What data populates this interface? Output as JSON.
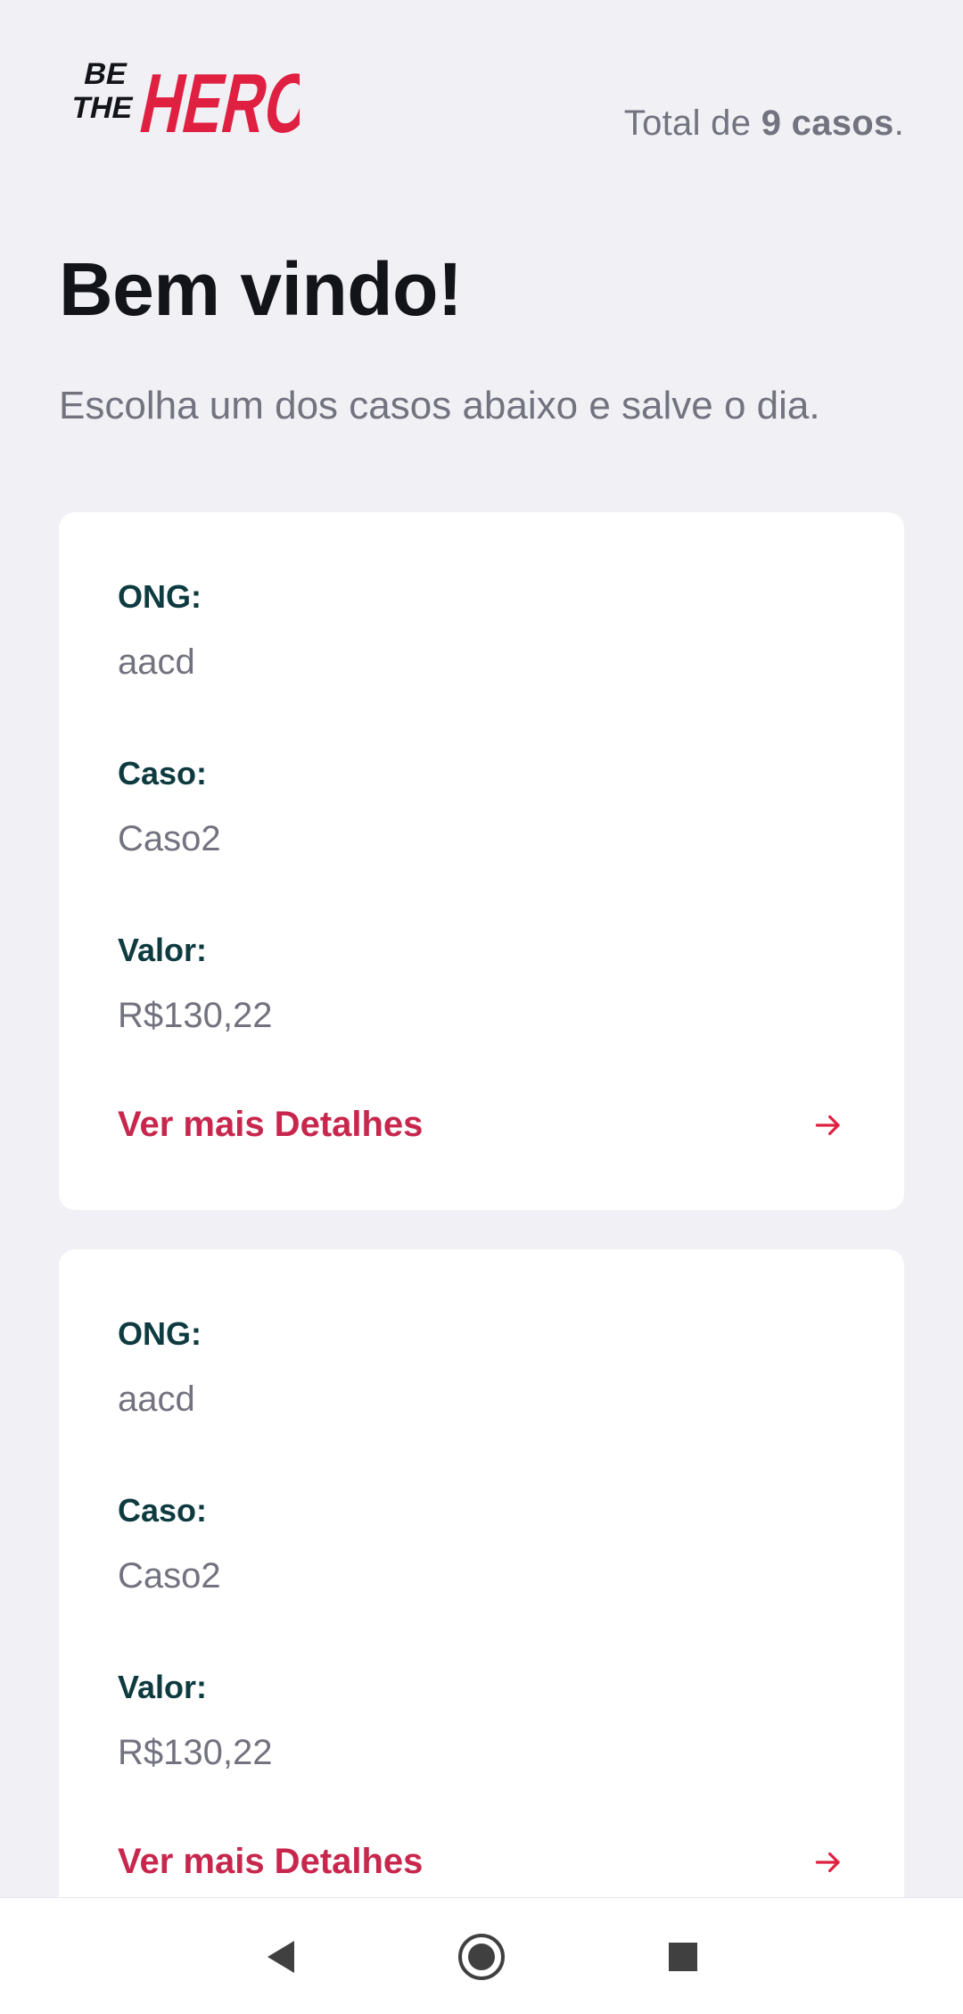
{
  "header": {
    "logo_alt": "Be The Hero",
    "total_prefix": "Total de ",
    "total_bold": "9 casos",
    "total_suffix": "."
  },
  "title": "Bem vindo!",
  "subtitle": "Escolha um dos casos abaixo e salve o dia.",
  "colors": {
    "background": "#f0f0f5",
    "brand": "#e02041",
    "label": "#0e3b40",
    "muted": "#737380",
    "link": "#c7274d"
  },
  "cards": [
    {
      "ong_label": "ONG:",
      "ong_value": "aacd",
      "case_label": "Caso:",
      "case_value": "Caso2",
      "value_label": "Valor:",
      "value_value": "R$130,22",
      "details_label": "Ver mais Detalhes",
      "details_icon": "arrow-right-icon"
    },
    {
      "ong_label": "ONG:",
      "ong_value": "aacd",
      "case_label": "Caso:",
      "case_value": "Caso2",
      "value_label": "Valor:",
      "value_value": "R$130,22",
      "details_label": "Ver mais Detalhes",
      "details_icon": "arrow-right-icon"
    }
  ],
  "navbar": {
    "back_icon": "back-triangle-icon",
    "home_icon": "home-circle-icon",
    "recents_icon": "recents-square-icon"
  }
}
